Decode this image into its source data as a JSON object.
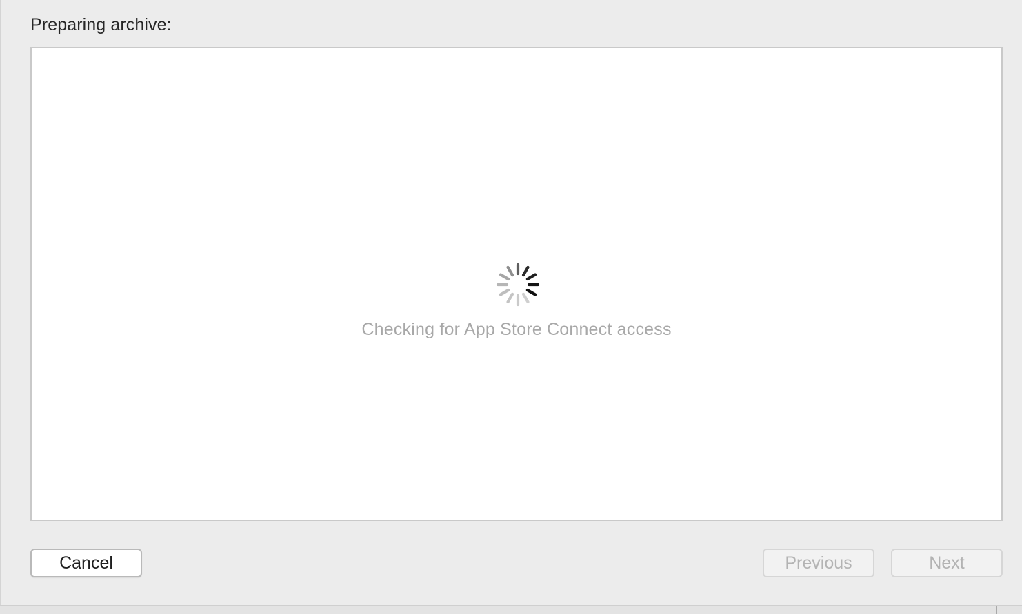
{
  "dialog": {
    "header_label": "Preparing archive:",
    "status_text": "Checking for App Store Connect access",
    "spinner_icon": "activity-spinner-icon"
  },
  "buttons": {
    "cancel_label": "Cancel",
    "previous_label": "Previous",
    "next_label": "Next"
  },
  "colors": {
    "window_background": "#ececec",
    "panel_background": "#ffffff",
    "status_text": "#a8a8a8",
    "disabled_button_text": "#b3b3b3"
  }
}
